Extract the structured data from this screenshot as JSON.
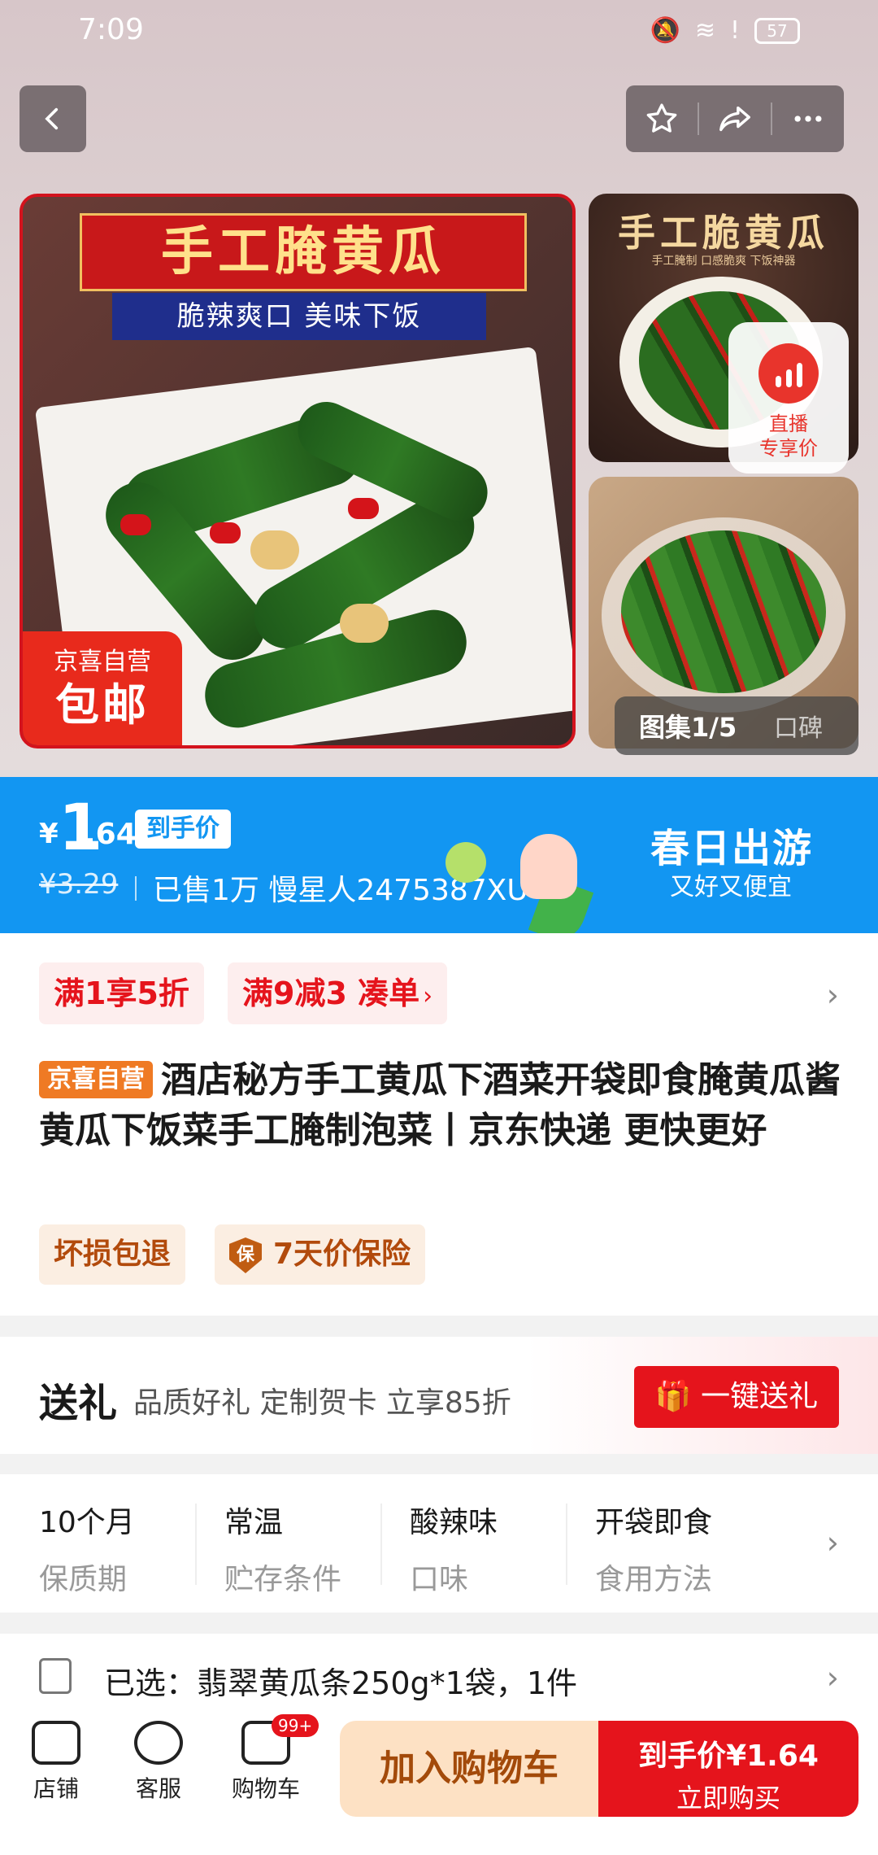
{
  "status_bar": {
    "time": "7:09",
    "battery": "57"
  },
  "hero": {
    "main_image_banner": "手工腌黄瓜",
    "main_image_sub": "脆辣爽口 美味下饭",
    "main_badge_line1": "京喜自营",
    "main_badge_line2": "包邮",
    "thumb1_title": "手工脆黄瓜",
    "thumb1_sub": "手工腌制  口感脆爽  下饭神器",
    "live_label_line1": "直播",
    "live_label_line2": "专享价",
    "gallery_label": "图集1/5",
    "reviews_label": "口碑"
  },
  "price": {
    "currency": "¥",
    "integer": "1",
    "decimal": ".64",
    "tag": "到手价",
    "original": "¥3.29",
    "sold": "已售1万 慢星人2475387XU",
    "campaign_title": "春日出游",
    "campaign_sub": "又好又便宜"
  },
  "promos": [
    {
      "text": "满1享5折"
    },
    {
      "text": "满9减3 凑单",
      "arrow": "›"
    }
  ],
  "product": {
    "badge": "京喜自营",
    "title": "酒店秘方手工黄瓜下酒菜开袋即食腌黄瓜酱黄瓜下饭菜手工腌制泡菜丨京东快递 更快更好",
    "services": [
      "坏损包退",
      "7天价保险"
    ],
    "shield": "保"
  },
  "gift": {
    "heading": "送礼",
    "desc": "品质好礼 定制贺卡 立享85折",
    "button": "一键送礼"
  },
  "attributes": [
    {
      "value": "10个月",
      "key": "保质期"
    },
    {
      "value": "常温",
      "key": "贮存条件"
    },
    {
      "value": "酸辣味",
      "key": "口味"
    },
    {
      "value": "开袋即食",
      "key": "食用方法"
    }
  ],
  "selected": "已选：翡翠黄瓜条250g*1袋，1件",
  "bottom_nav": {
    "shop": "店铺",
    "service": "客服",
    "cart": "购物车",
    "cart_count": "99+",
    "add_to_cart": "加入购物车",
    "buy_price": "到手价¥1.64",
    "buy_now": "立即购买"
  },
  "colors": {
    "accent_red": "#e5141c",
    "price_blue": "#1296f2",
    "self_run_orange": "#ef7a24"
  }
}
